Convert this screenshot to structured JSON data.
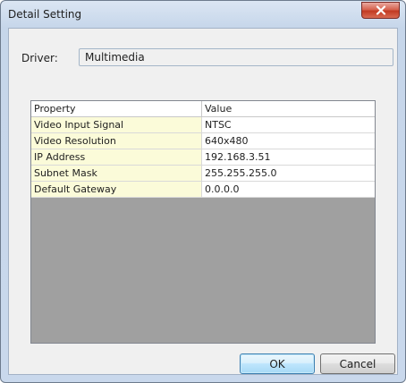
{
  "window": {
    "title": "Detail Setting"
  },
  "driver": {
    "label": "Driver:",
    "value": "Multimedia"
  },
  "grid": {
    "headers": [
      "Property",
      "Value"
    ],
    "rows": [
      [
        "Video Input Signal",
        "NTSC"
      ],
      [
        "Video Resolution",
        "640x480"
      ],
      [
        "IP Address",
        "192.168.3.51"
      ],
      [
        "Subnet Mask",
        "255.255.255.0"
      ],
      [
        "Default Gateway",
        "0.0.0.0"
      ]
    ]
  },
  "buttons": {
    "ok_label": "OK",
    "cancel_label": "Cancel"
  },
  "icons": {
    "close": "close-icon"
  },
  "colors": {
    "property_cell_bg": "#fbfbd9",
    "grid_empty_bg": "#a0a0a0",
    "close_button": "#c23a22"
  }
}
